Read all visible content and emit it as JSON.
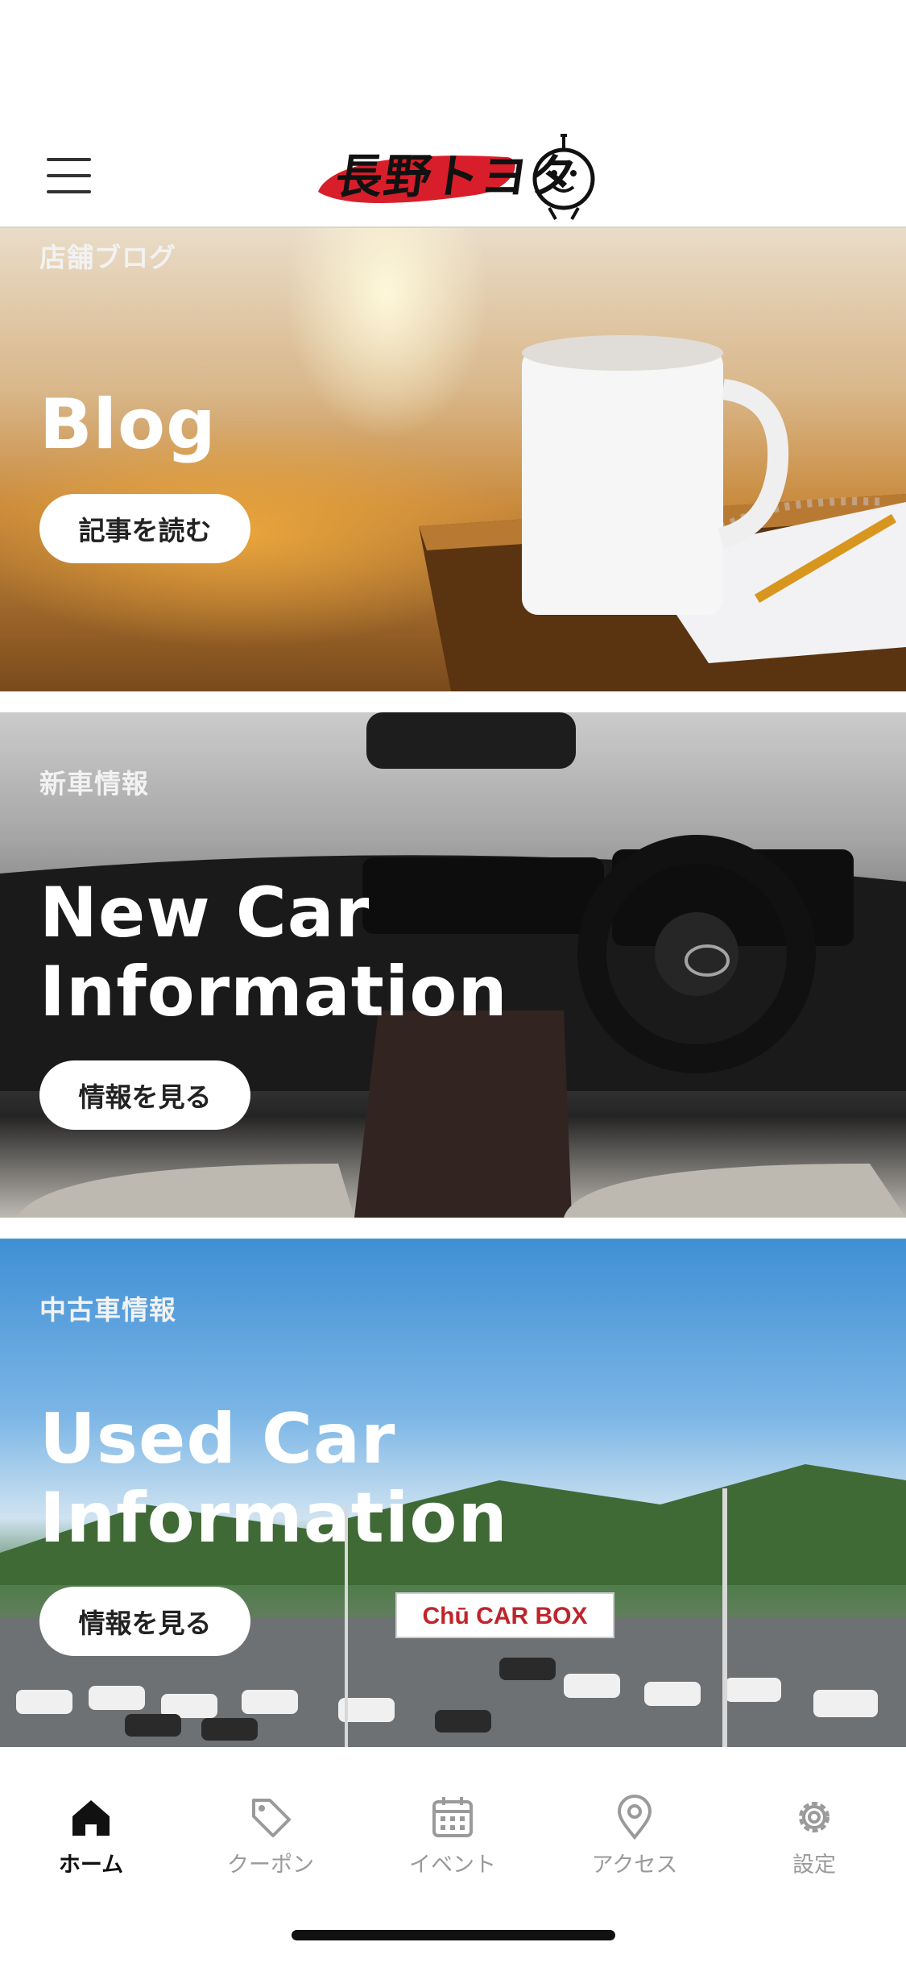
{
  "header": {
    "logo_text": "長野トヨタ"
  },
  "panels": [
    {
      "category": "店舗ブログ",
      "title_lines": [
        "Blog"
      ],
      "button": "記事を読む"
    },
    {
      "category": "新車情報",
      "title_lines": [
        "New Car",
        "Information"
      ],
      "button": "情報を見る"
    },
    {
      "category": "中古車情報",
      "title_lines": [
        "Used Car",
        "Information"
      ],
      "button": "情報を見る",
      "sign_text": "Chū CAR BOX"
    }
  ],
  "tabbar": {
    "items": [
      {
        "label": "ホーム",
        "icon": "home-icon",
        "active": true
      },
      {
        "label": "クーポン",
        "icon": "tag-icon"
      },
      {
        "label": "イベント",
        "icon": "calendar-icon"
      },
      {
        "label": "アクセス",
        "icon": "map-pin-icon"
      },
      {
        "label": "設定",
        "icon": "gear-icon"
      }
    ]
  },
  "colors": {
    "logo_red": "#d81e2a",
    "nav_active": "#111111",
    "nav_inactive": "#9a9a9a"
  }
}
